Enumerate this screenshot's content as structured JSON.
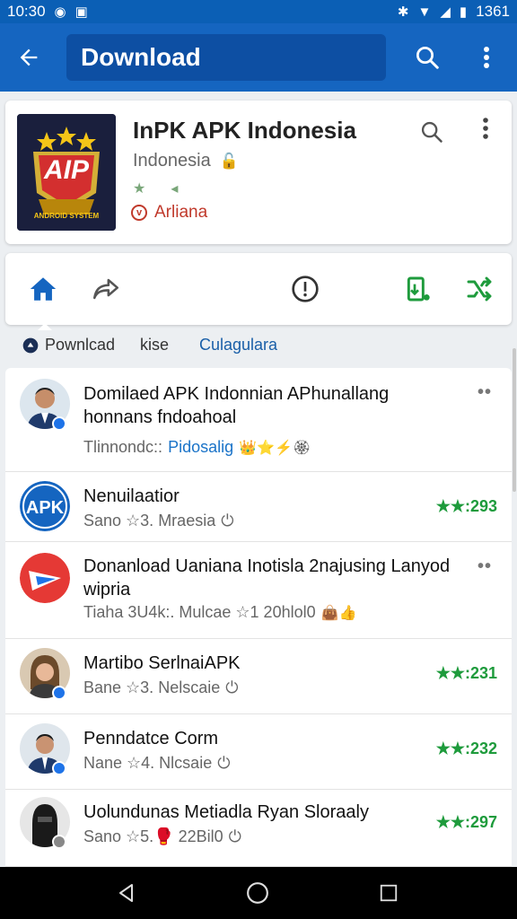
{
  "status_bar": {
    "time": "10:30",
    "battery": "1361"
  },
  "toolbar": {
    "title": "Download"
  },
  "app": {
    "name": "InPK APK Indonesia",
    "region": "Indonesia",
    "developer": "Arliana",
    "logo_text": "AIP",
    "logo_caption": "ANDROID SYSTEM"
  },
  "tabs": [
    {
      "label": "Pownlcad"
    },
    {
      "label": "kise"
    },
    {
      "label": "Culagulara"
    }
  ],
  "list": [
    {
      "title": "Domilaed APK Indonnian APhunallang honnans fndoahoal",
      "meta_text": "Tlinnondc::",
      "meta_link": "Pidosalig",
      "meta_tail": "👑⭐⚡🏵",
      "rating": ""
    },
    {
      "title": "Nenuilaatior",
      "meta_text": "Sano ☆3. Mraesia",
      "meta_link": "",
      "meta_tail": "",
      "rating": "★★:293"
    },
    {
      "title": "Donanload Uaniana Inotisla 2najusing Lanyod wipria",
      "meta_text": "Tiaha 3U4k:. Mulcae ☆1 20hlol0",
      "meta_link": "",
      "meta_tail": "👜👍",
      "rating": ""
    },
    {
      "title": "Martibo SerlnaiAPK",
      "meta_text": "Bane ☆3. Nelscaie",
      "meta_link": "",
      "meta_tail": "",
      "rating": "★★:231"
    },
    {
      "title": "Penndatce Corm",
      "meta_text": "Nane ☆4. Nlcsaie",
      "meta_link": "",
      "meta_tail": "",
      "rating": "★★:232"
    },
    {
      "title": "Uolundunas Metiadla Ryan Sloraaly",
      "meta_text": "Sano ☆5.🥊 22Bil0",
      "meta_link": "",
      "meta_tail": "",
      "rating": "★★:297"
    }
  ],
  "colors": {
    "primary": "#1565c0",
    "accent_green": "#1e9b3c",
    "developer_red": "#c0392b"
  },
  "icons": [
    "back-arrow-icon",
    "search-icon",
    "more-vert-icon",
    "home-icon",
    "share-icon",
    "info-icon",
    "install-icon",
    "shuffle-icon",
    "nav-back-icon",
    "nav-home-icon",
    "nav-recents-icon"
  ]
}
